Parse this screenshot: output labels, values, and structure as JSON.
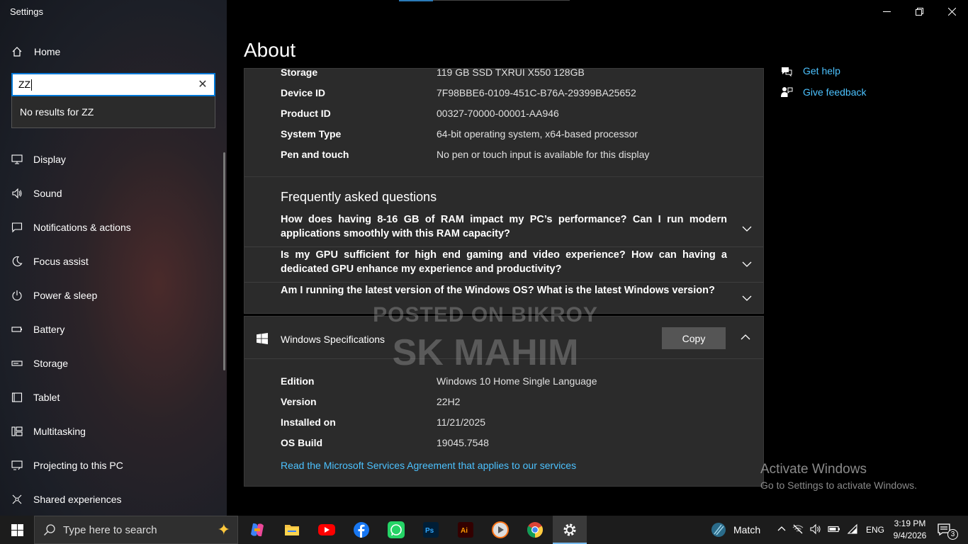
{
  "window": {
    "title": "Settings"
  },
  "sidebar": {
    "home_label": "Home",
    "search_value": "ZZ",
    "no_results": "No results for ZZ",
    "items": [
      {
        "label": "Display"
      },
      {
        "label": "Sound"
      },
      {
        "label": "Notifications & actions"
      },
      {
        "label": "Focus assist"
      },
      {
        "label": "Power & sleep"
      },
      {
        "label": "Battery"
      },
      {
        "label": "Storage"
      },
      {
        "label": "Tablet"
      },
      {
        "label": "Multitasking"
      },
      {
        "label": "Projecting to this PC"
      },
      {
        "label": "Shared experiences"
      }
    ]
  },
  "page": {
    "title": "About"
  },
  "device_specs": [
    {
      "key": "Storage",
      "value": "119 GB SSD TXRUI X550 128GB"
    },
    {
      "key": "Device ID",
      "value": "7F98BBE6-0109-451C-B76A-29399BA25652"
    },
    {
      "key": "Product ID",
      "value": "00327-70000-00001-AA946"
    },
    {
      "key": "System Type",
      "value": "64-bit operating system, x64-based processor"
    },
    {
      "key": "Pen and touch",
      "value": "No pen or touch input is available for this display"
    }
  ],
  "faq": {
    "title": "Frequently asked questions",
    "items": [
      {
        "q": "How does having 8-16 GB of RAM impact my PC’s performance? Can I run modern applications smoothly with this RAM capacity?"
      },
      {
        "q": "Is my GPU sufficient for high end gaming and video experience? How can having a dedicated GPU enhance my experience and productivity?"
      },
      {
        "q": "Am I running the latest version of the Windows OS? What is the latest Windows version?"
      }
    ]
  },
  "windows_specs": {
    "title": "Windows Specifications",
    "copy_label": "Copy",
    "rows": [
      {
        "key": "Edition",
        "value": "Windows 10 Home Single Language"
      },
      {
        "key": "Version",
        "value": "22H2"
      },
      {
        "key": "Installed on",
        "value": "11/21/2025"
      },
      {
        "key": "OS Build",
        "value": "19045.7548"
      }
    ],
    "link": "Read the Microsoft Services Agreement that applies to our services"
  },
  "side_links": [
    {
      "label": "Get help"
    },
    {
      "label": "Give feedback"
    }
  ],
  "watermark": {
    "line1": "POSTED ON BIKROY",
    "line2": "SK MAHIM"
  },
  "activation": {
    "line1": "Activate Windows",
    "line2": "Go to Settings to activate Windows."
  },
  "taskbar": {
    "search_placeholder": "Type here to search",
    "weather_label": "Match",
    "language": "ENG",
    "time": "3:19 PM",
    "date": "9/4/2026",
    "notification_count": "3"
  },
  "colors": {
    "accent": "#0078d7",
    "link": "#4cc2ff",
    "panel": "#2b2b2b"
  }
}
